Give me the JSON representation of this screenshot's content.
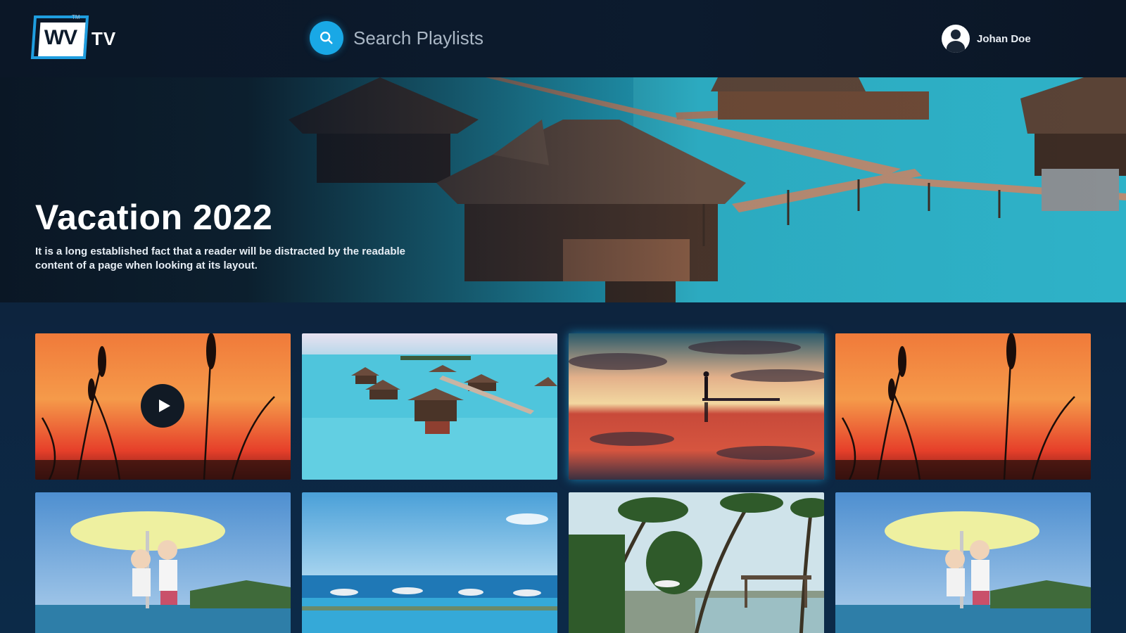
{
  "header": {
    "logo": {
      "mark": "WV",
      "tm": "TM",
      "suffix": "TV",
      "accent": "#1f9ee0"
    },
    "search": {
      "placeholder": "Search Playlists",
      "value": "",
      "accent": "#19a8e6"
    },
    "user": {
      "name": "Johan Doe"
    }
  },
  "hero": {
    "title": "Vacation 2022",
    "description": "It is a long established fact that a reader will be distracted by the readable content of a page when looking at its layout."
  },
  "grid": {
    "selected_index": 2,
    "tiles": [
      {
        "scene": "sunset-reeds",
        "has_play": true
      },
      {
        "scene": "overwater-bungalows"
      },
      {
        "scene": "sunset-reflection"
      },
      {
        "scene": "sunset-reeds"
      },
      {
        "scene": "kids-umbrella-beach"
      },
      {
        "scene": "ocean-resort"
      },
      {
        "scene": "palm-beach"
      },
      {
        "scene": "kids-umbrella-beach"
      }
    ],
    "highlight_color": "#22b5ef"
  }
}
